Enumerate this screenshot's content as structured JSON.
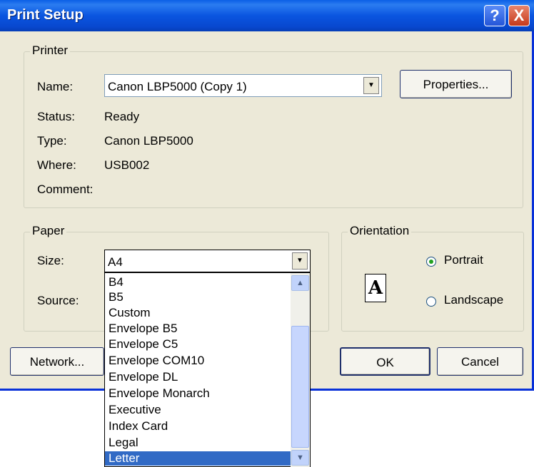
{
  "title": "Print Setup",
  "title_buttons": {
    "help": "?",
    "close": "X"
  },
  "printer": {
    "group_label": "Printer",
    "name_label": "Name:",
    "name_value": "Canon LBP5000 (Copy 1)",
    "properties_button": "Properties...",
    "status_label": "Status:",
    "status_value": "Ready",
    "type_label": "Type:",
    "type_value": "Canon LBP5000",
    "where_label": "Where:",
    "where_value": "USB002",
    "comment_label": "Comment:"
  },
  "paper": {
    "group_label": "Paper",
    "size_label": "Size:",
    "size_value": "A4",
    "source_label": "Source:"
  },
  "orientation": {
    "group_label": "Orientation",
    "portrait": "Portrait",
    "landscape": "Landscape",
    "selected": "Portrait",
    "page_glyph": "A"
  },
  "buttons": {
    "network": "Network...",
    "ok": "OK",
    "cancel": "Cancel"
  },
  "size_dropdown": {
    "options": [
      "B4",
      "B5",
      "Custom",
      "Envelope B5",
      "Envelope C5",
      "Envelope COM10",
      "Envelope DL",
      "Envelope Monarch",
      "Executive",
      "Index Card",
      "Legal",
      "Letter"
    ],
    "highlighted": "Letter"
  },
  "colors": {
    "titlebar": "#0a55e0",
    "dialog_bg": "#ece9d8",
    "selection": "#316ac5"
  }
}
